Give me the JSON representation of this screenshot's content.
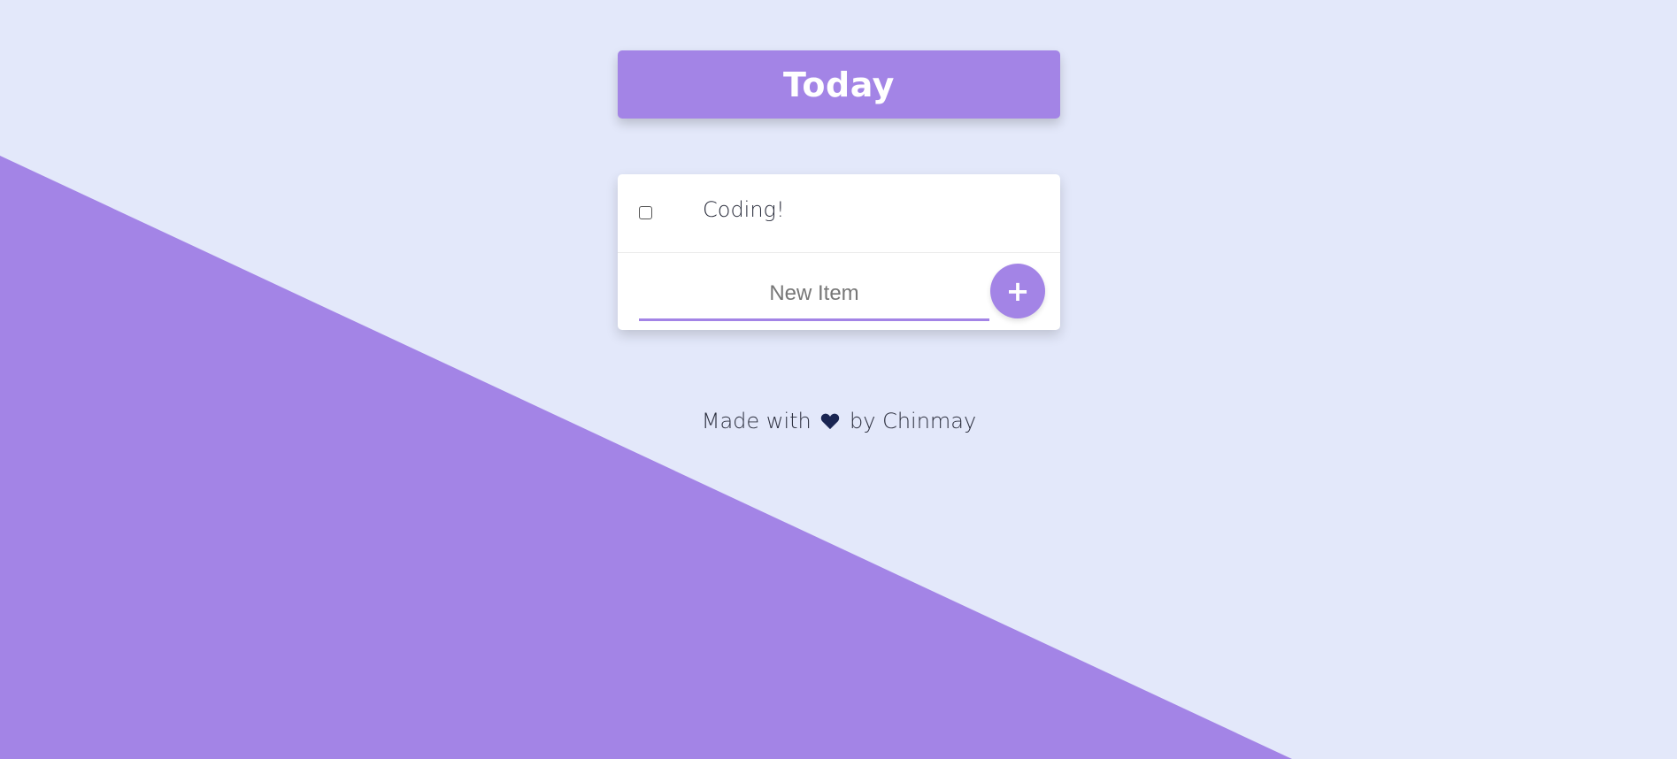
{
  "header": {
    "title": "Today"
  },
  "list": {
    "items": [
      {
        "label": "Coding!",
        "checked": false
      }
    ]
  },
  "new_item": {
    "placeholder": "New Item",
    "add_label": "+"
  },
  "footer": {
    "prefix": "Made with",
    "icon": "heart-icon",
    "suffix": "by Chinmay"
  },
  "colors": {
    "background": "#e3e8fa",
    "accent": "#a384e6",
    "heart": "#1a2552",
    "text": "#2c2f3e"
  }
}
